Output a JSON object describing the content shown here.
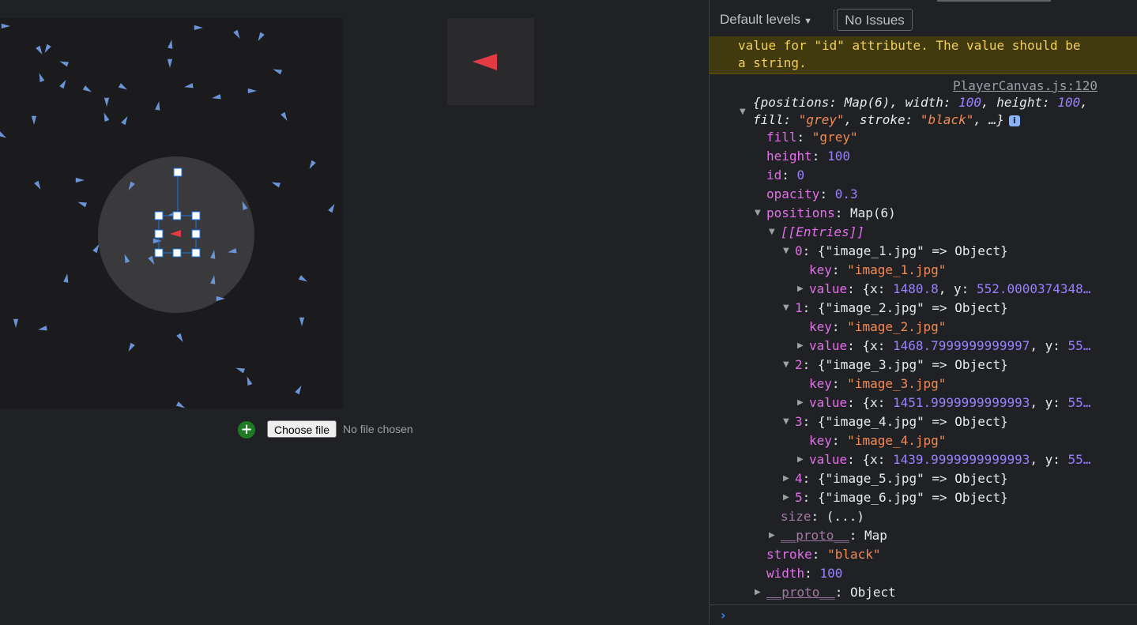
{
  "canvas_app": {
    "add_label": "+",
    "file_button": "Choose file",
    "file_status": "No file chosen",
    "triangle_color": "#6b93d6",
    "player_color": "#e33b45"
  },
  "console": {
    "levels": "Default levels",
    "issues": "No Issues",
    "warning_text": "value for \"id\" attribute. The value should be\na string.",
    "source": "PlayerCanvas.js:120",
    "summary": {
      "positions_key": "positions",
      "positions_val": "Map(6)",
      "width_key": "width",
      "width_val": "100",
      "height_key": "height",
      "height_val": "100",
      "fill_key": "fill",
      "fill_val": "\"grey\"",
      "stroke_key": "stroke",
      "stroke_val": "\"black\"",
      "ellipsis": "…}",
      "info": "i"
    },
    "props": {
      "fill_key": "fill",
      "fill_val": "\"grey\"",
      "height_key": "height",
      "height_val": "100",
      "id_key": "id",
      "id_val": "0",
      "opacity_key": "opacity",
      "opacity_val": "0.3",
      "positions_key": "positions",
      "positions_val": "Map(6)",
      "entries": "[[Entries]]",
      "size_key": "size",
      "size_val": "(...)",
      "mproto_key": "__proto__",
      "mproto_val": "Map",
      "stroke_key": "stroke",
      "stroke_val": "\"black\"",
      "width_key": "width",
      "width_val": "100",
      "oproto_key": "__proto__",
      "oproto_val": "Object"
    },
    "map_entries": [
      {
        "index": "0",
        "name": "{\"image_1.jpg\" => Object}",
        "key": "\"image_1.jpg\"",
        "x": "1480.8",
        "y_key": "y:",
        "y": "552.0000374348…"
      },
      {
        "index": "1",
        "name": "{\"image_2.jpg\" => Object}",
        "key": "\"image_2.jpg\"",
        "x": "1468.7999999999997",
        "y_key": "y:",
        "y": "55…"
      },
      {
        "index": "2",
        "name": "{\"image_3.jpg\" => Object}",
        "key": "\"image_3.jpg\"",
        "x": "1451.9999999999993",
        "y_key": "y:",
        "y": "55…"
      },
      {
        "index": "3",
        "name": "{\"image_4.jpg\" => Object}",
        "key": "\"image_4.jpg\"",
        "x": "1439.9999999999993",
        "y_key": "y:",
        "y": "55…"
      },
      {
        "index": "4",
        "name": "{\"image_5.jpg\" => Object}"
      },
      {
        "index": "5",
        "name": "{\"image_6.jpg\" => Object}"
      }
    ],
    "kw": {
      "key": "key",
      "value": "value",
      "xopen": "{x:"
    },
    "prompt": "›"
  }
}
